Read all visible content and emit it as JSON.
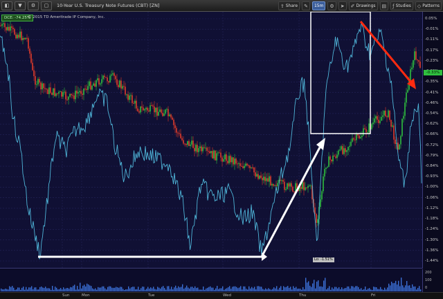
{
  "window": {
    "title": "10-Year U.S. Treasury Note Futures (CBT) [ZN]",
    "copyright": "© 2015 TD Ameritrade IP Company, Inc.",
    "time_readout": "12:57:29"
  },
  "toolbar": {
    "left_buttons": [
      "◧",
      "▼",
      "⚙",
      "▢"
    ],
    "right_tools": [
      {
        "icon": "share-icon",
        "label": "Share"
      },
      {
        "icon": "pencil-icon",
        "label": ""
      },
      {
        "icon": "zoom-icon",
        "label": "15m"
      },
      {
        "icon": "settings-icon",
        "label": ""
      },
      {
        "icon": "cursor-icon",
        "label": ""
      },
      {
        "icon": "drawing-icon",
        "label": "Drawings"
      },
      {
        "icon": "chart-icon",
        "label": ""
      },
      {
        "icon": "studies-icon",
        "label": "Studies"
      },
      {
        "icon": "pattern-icon",
        "label": "Patterns"
      }
    ]
  },
  "indicator_badge": "DCE: -74.25%",
  "price_tag": "-0.33%",
  "low_tag": "Lo: -1.51%",
  "lower_pane": {
    "labels": [
      "200",
      "100",
      "0"
    ],
    "vertical_label": "Volume"
  },
  "price_axis_labels": [
    "0.05%",
    "-0.01%",
    "-0.11%",
    "-0.17%",
    "-0.23%",
    "-0.29%",
    "-0.35%",
    "-0.41%",
    "-0.46%",
    "-0.54%",
    "-0.62%",
    "-0.66%",
    "-0.72%",
    "-0.79%",
    "-0.84%",
    "-0.93%",
    "-1.00%",
    "-1.06%",
    "-1.12%",
    "-1.18%",
    "-1.24%",
    "-1.30%",
    "-1.36%",
    "-1.44%"
  ],
  "time_axis_labels": [
    "Sun",
    "Mon",
    "Tue",
    "Wed",
    "Thu",
    "Fri"
  ],
  "colors": {
    "background": "#101034",
    "up_candle": "#2fbf3f",
    "down_candle": "#e03a2a",
    "indicator_line": "#4fb5d8",
    "annotation_white": "#ffffff",
    "annotation_red": "#ff2a10"
  },
  "chart_data": {
    "type": "line",
    "title": "10-Year U.S. Treasury Note Futures (CBT) [ZN]",
    "xlabel": "",
    "ylabel": "",
    "x": [
      "Sun",
      "Mon",
      "Tue",
      "Wed",
      "Thu",
      "Fri"
    ],
    "series": [
      {
        "values": [
          0.02,
          -0.32,
          -0.46,
          -0.7,
          -0.84,
          -0.1,
          -0.33
        ]
      },
      {
        "values": [
          -0.2,
          -0.9,
          -0.6,
          -1.3,
          -0.6,
          -0.1,
          -0.9
        ]
      }
    ],
    "ylim": [
      -1.48,
      0.08
    ],
    "grid": true,
    "legend": "none"
  }
}
